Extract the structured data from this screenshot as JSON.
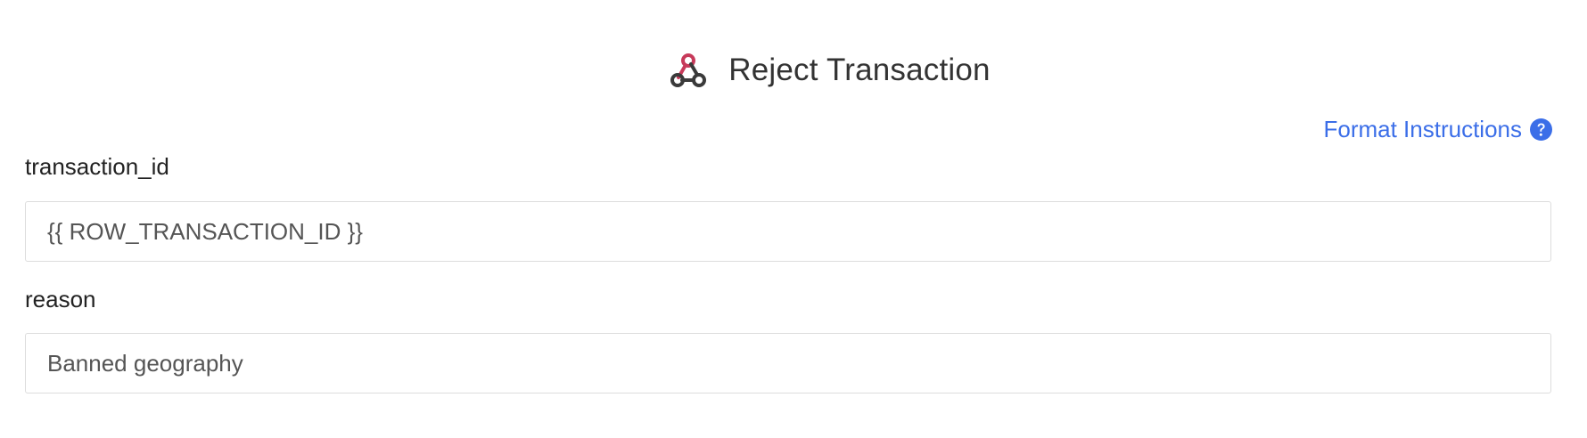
{
  "header": {
    "title": "Reject Transaction",
    "icon": "webhook-icon"
  },
  "format_instructions": {
    "label": "Format Instructions",
    "icon": "question-circle-icon",
    "color": "#3b6ee8"
  },
  "fields": [
    {
      "label": "transaction_id",
      "value": "{{ ROW_TRANSACTION_ID }}"
    },
    {
      "label": "reason",
      "value": "Banned geography"
    }
  ],
  "colors": {
    "icon_accent": "#c73a5a",
    "icon_dark": "#3a3a3a",
    "link": "#3b6ee8",
    "border": "#dddddd"
  }
}
